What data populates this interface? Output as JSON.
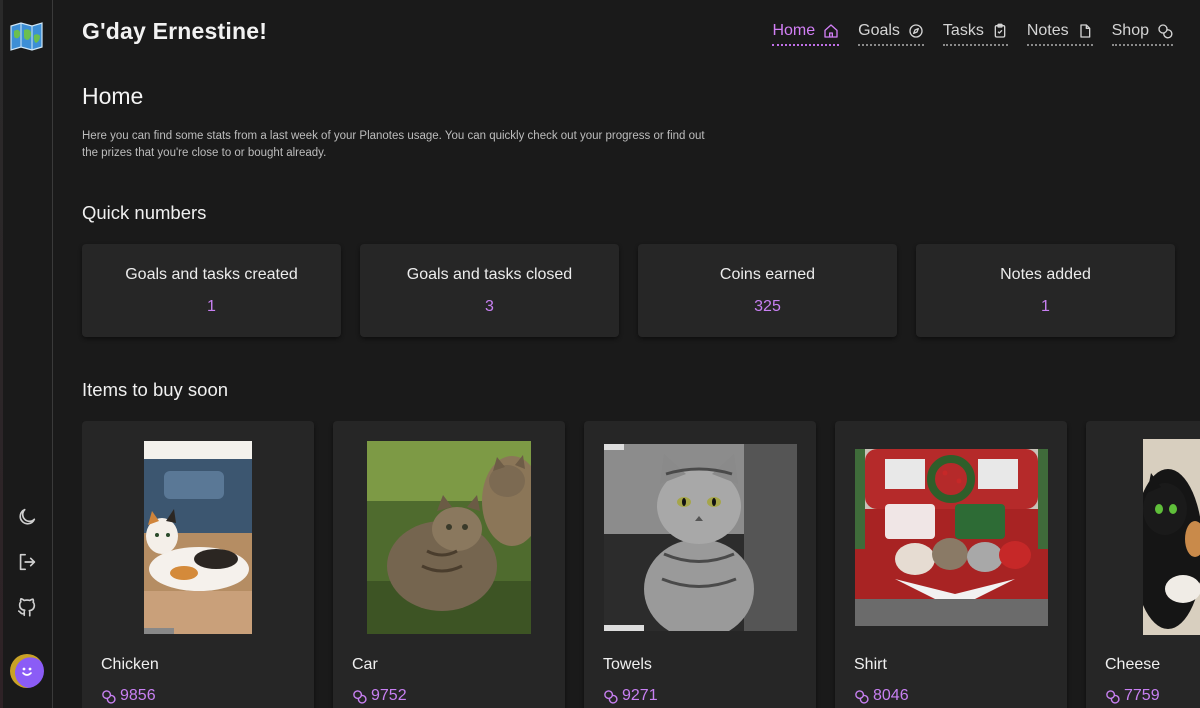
{
  "greeting": "G'day Ernestine!",
  "nav": [
    {
      "label": "Home",
      "icon": "house-icon",
      "active": true
    },
    {
      "label": "Goals",
      "icon": "compass-icon",
      "active": false
    },
    {
      "label": "Tasks",
      "icon": "clipboard-check-icon",
      "active": false
    },
    {
      "label": "Notes",
      "icon": "file-icon",
      "active": false
    },
    {
      "label": "Shop",
      "icon": "coins-icon",
      "active": false
    }
  ],
  "sidebar": {
    "logo_icon": "map-icon",
    "icons": [
      "moon-icon",
      "logout-icon",
      "github-icon"
    ],
    "avatar_icon": "smiley-avatar"
  },
  "page": {
    "title": "Home",
    "intro": "Here you can find some stats from a last week of your Planotes usage. You can quickly check out your progress or find out the prizes that you're close to or bought already."
  },
  "quick_numbers": {
    "title": "Quick numbers",
    "stats": [
      {
        "label": "Goals and tasks created",
        "value": "1"
      },
      {
        "label": "Goals and tasks closed",
        "value": "3"
      },
      {
        "label": "Coins earned",
        "value": "325"
      },
      {
        "label": "Notes added",
        "value": "1"
      }
    ]
  },
  "items_to_buy": {
    "title": "Items to buy soon",
    "items": [
      {
        "name": "Chicken",
        "price": "9856",
        "image": "calico-kitten-photo"
      },
      {
        "name": "Car",
        "price": "9752",
        "image": "tabby-kittens-photo"
      },
      {
        "name": "Towels",
        "price": "9271",
        "image": "grey-tabby-cat-photo"
      },
      {
        "name": "Shirt",
        "price": "8046",
        "image": "cats-in-truck-photo"
      },
      {
        "name": "Cheese",
        "price": "7759",
        "image": "black-cat-photo"
      }
    ]
  },
  "colors": {
    "background": "#1a1a1a",
    "card": "#262626",
    "accent": "#c880f2"
  }
}
